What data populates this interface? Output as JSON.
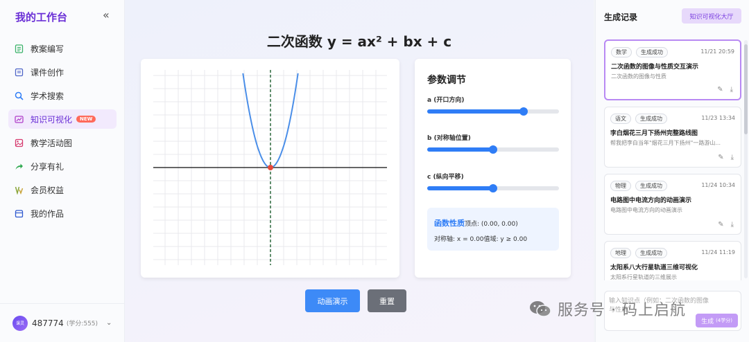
{
  "sidebar": {
    "brand": "我的工作台",
    "collapse_icon": "«",
    "items": [
      {
        "label": "教案编写",
        "icon": "doc-icon",
        "color": "#3bb26a"
      },
      {
        "label": "课件创作",
        "icon": "slides-icon",
        "color": "#4f66c8"
      },
      {
        "label": "学术搜索",
        "icon": "search-icon",
        "color": "#2f7df6"
      },
      {
        "label": "知识可视化",
        "icon": "chart-icon",
        "color": "#b03ec9",
        "badge": "NEW",
        "active": true
      },
      {
        "label": "教学活动图",
        "icon": "image-icon",
        "color": "#d63a6e"
      },
      {
        "label": "分享有礼",
        "icon": "share-icon",
        "color": "#2ea84f"
      },
      {
        "label": "会员权益",
        "icon": "vip-icon",
        "color": "#8aa63a"
      },
      {
        "label": "我的作品",
        "icon": "folder-icon",
        "color": "#2f5ad0"
      }
    ],
    "user": {
      "avatar_text": "课灵",
      "id": "487774",
      "credits": "(学分:555)",
      "caret": "⌄"
    }
  },
  "main": {
    "title": "二次函数 y = ax² + bx + c",
    "params": {
      "title": "参数调节",
      "a_label": "a (开口方向)",
      "a_value": 0.73,
      "b_label": "b (对称轴位置)",
      "b_value": 0.5,
      "c_label": "c (纵向平移)",
      "c_value": 0.5
    },
    "props": {
      "title": "函数性质",
      "vertex": "顶点: (0.00, 0.00)",
      "axis": "对称轴: x = 0.00",
      "range": "值域: y ≥ 0.00"
    },
    "buttons": {
      "animate": "动画演示",
      "reset": "重置"
    }
  },
  "right_panel": {
    "title": "生成记录",
    "hall_button": "知识可视化大厅",
    "records": [
      {
        "subject": "数学",
        "status": "生成成功",
        "time": "11/21 20:59",
        "title": "二次函数的图像与性质交互演示",
        "desc": "二次函数的图像与性质",
        "active": true
      },
      {
        "subject": "语文",
        "status": "生成成功",
        "time": "11/23 13:34",
        "title": "李白烟花三月下扬州完整路线图",
        "desc": "帮我把李白当年\"烟花三月下扬州\"一路游山..."
      },
      {
        "subject": "物理",
        "status": "生成成功",
        "time": "11/24 10:34",
        "title": "电路图中电流方向的动画演示",
        "desc": "电路图中电流方向的动画演示"
      },
      {
        "subject": "地理",
        "status": "生成成功",
        "time": "11/24 11:19",
        "title": "太阳系八大行星轨道三维可视化",
        "desc": "太阳系行星轨道的三维展示"
      }
    ],
    "input_placeholder": "输入知识点（例如：二次函数的图像与性质）",
    "generate_label": "生成",
    "generate_cost": "(4学分)"
  },
  "chart_data": {
    "type": "line",
    "title": "",
    "xlabel": "",
    "ylabel": "",
    "series": [
      {
        "function": "y = x²",
        "vertex": [
          0,
          0
        ],
        "color": "#4a8ee8"
      }
    ],
    "symmetry_axis_x": 0,
    "grid": true
  },
  "watermark": "服务号 · 码上启航"
}
